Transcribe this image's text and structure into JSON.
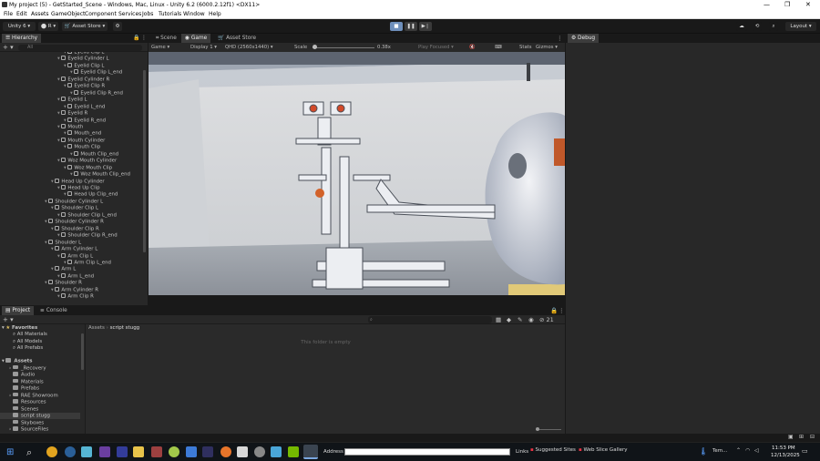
{
  "window": {
    "title": "My project (5) - GetStarted_Scene - Windows, Mac, Linux - Unity 6.2 (6000.2.12f1) <DX11>"
  },
  "menu": [
    "File",
    "Edit",
    "Assets",
    "GameObject",
    "Component",
    "Services",
    "Jobs",
    "Tutorials",
    "Window",
    "Help"
  ],
  "toolbar": {
    "account": "Unity 6",
    "asset_store": "Asset Store",
    "layout": "Layout"
  },
  "hierarchy": {
    "tab": "Hierarchy",
    "search_placeholder": "All",
    "items": [
      {
        "label": "Eyelid Clip L",
        "indent": 4
      },
      {
        "label": "Eyelid Cylinder L",
        "indent": 3
      },
      {
        "label": "Eyelid Clip L",
        "indent": 4
      },
      {
        "label": "Eyelid Clip L_end",
        "indent": 5
      },
      {
        "label": "Eyelid Cylinder R",
        "indent": 3
      },
      {
        "label": "Eyelid Clip R",
        "indent": 4
      },
      {
        "label": "Eyelid Clip R_end",
        "indent": 5
      },
      {
        "label": "Eyelid L",
        "indent": 3
      },
      {
        "label": "Eyelid L_end",
        "indent": 4
      },
      {
        "label": "Eyelid R",
        "indent": 3
      },
      {
        "label": "Eyelid R_end",
        "indent": 4
      },
      {
        "label": "Mouth",
        "indent": 3
      },
      {
        "label": "Mouth_end",
        "indent": 4
      },
      {
        "label": "Mouth Cylinder",
        "indent": 3
      },
      {
        "label": "Mouth Clip",
        "indent": 4
      },
      {
        "label": "Mouth Clip_end",
        "indent": 5
      },
      {
        "label": "Woz Mouth Cylinder",
        "indent": 3
      },
      {
        "label": "Woz Mouth Clip",
        "indent": 4
      },
      {
        "label": "Woz Mouth Clip_end",
        "indent": 5
      },
      {
        "label": "Head Up Cylinder",
        "indent": 2
      },
      {
        "label": "Head Up Clip",
        "indent": 3
      },
      {
        "label": "Head Up Clip_end",
        "indent": 4
      },
      {
        "label": "Shoulder Cylinder L",
        "indent": 1
      },
      {
        "label": "Shoulder Clip L",
        "indent": 2
      },
      {
        "label": "Shoulder Clip L_end",
        "indent": 3
      },
      {
        "label": "Shoulder Cylinder R",
        "indent": 1
      },
      {
        "label": "Shoulder Clip R",
        "indent": 2
      },
      {
        "label": "Shoulder Clip R_end",
        "indent": 3
      },
      {
        "label": "Shoulder L",
        "indent": 1
      },
      {
        "label": "Arm Cylinder L",
        "indent": 2
      },
      {
        "label": "Arm Clip L",
        "indent": 3
      },
      {
        "label": "Arm Clip L_end",
        "indent": 4
      },
      {
        "label": "Arm L",
        "indent": 2
      },
      {
        "label": "Arm L_end",
        "indent": 3
      },
      {
        "label": "Shoulder R",
        "indent": 1
      },
      {
        "label": "Arm Cylinder R",
        "indent": 2
      },
      {
        "label": "Arm Clip R",
        "indent": 3
      }
    ]
  },
  "scene_tabs": [
    "Scene",
    "Game",
    "Asset Store"
  ],
  "game_bar": {
    "mode": "Game",
    "display": "Display 1",
    "resolution": "QHD (2560x1440)",
    "scale_label": "Scale",
    "scale_value": "0.38x",
    "play_focused": "Play Focused",
    "stats": "Stats",
    "gizmos": "Gizmos"
  },
  "debug": {
    "tab": "Debug"
  },
  "project": {
    "tabs": [
      "Project",
      "Console"
    ],
    "favorites_label": "Favorites",
    "favorites": [
      "All Materials",
      "All Models",
      "All Prefabs"
    ],
    "assets_label": "Assets",
    "folders": [
      "_Recovery",
      "Audio",
      "Materials",
      "Prefabs",
      "RAE Showroom",
      "Resources",
      "Scenes",
      "script stugg",
      "Skyboxes",
      "SourceFiles"
    ],
    "breadcrumb_root": "Assets",
    "breadcrumb_current": "script stugg",
    "empty_message": "This folder is empty",
    "count": "21"
  },
  "taskbar": {
    "address_label": "Address",
    "links_label": "Links",
    "suggested_sites": "Suggested Sites",
    "web_slice_gallery": "Web Slice Gallery",
    "weather": "Tem...",
    "time": "11:53 PM",
    "date": "12/13/2025"
  }
}
